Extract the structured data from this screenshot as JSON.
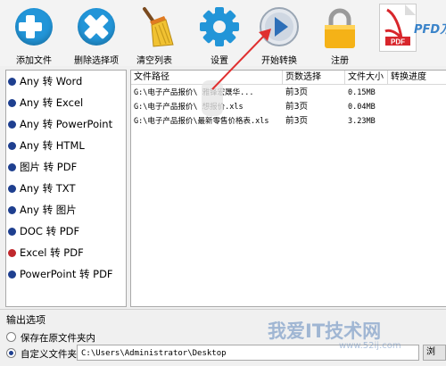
{
  "toolbar": {
    "add_file": "添加文件",
    "delete_selected": "删除选择项",
    "clear_list": "清空列表",
    "settings": "设置",
    "start_convert": "开始转换",
    "register": "注册",
    "brand_partial": "PFD万"
  },
  "converters": [
    {
      "label": "Any 转 Word",
      "color": "#1e3f8f"
    },
    {
      "label": "Any 转 Excel",
      "color": "#1e3f8f"
    },
    {
      "label": "Any 转 PowerPoint",
      "color": "#1e3f8f"
    },
    {
      "label": "Any 转 HTML",
      "color": "#1e3f8f"
    },
    {
      "label": "图片 转 PDF",
      "color": "#1e3f8f"
    },
    {
      "label": "Any 转 TXT",
      "color": "#1e3f8f"
    },
    {
      "label": "Any 转 图片",
      "color": "#1e3f8f"
    },
    {
      "label": "DOC 转 PDF",
      "color": "#1e3f8f"
    },
    {
      "label": "Excel 转 PDF",
      "color": "#c0282d"
    },
    {
      "label": "PowerPoint 转 PDF",
      "color": "#1e3f8f"
    }
  ],
  "table": {
    "headers": [
      "文件路径",
      "页数选择",
      "文件大小",
      "转换进度"
    ],
    "rows": [
      {
        "path": "G:\\电子产品报价\\      雅锋宏晟华...",
        "pages": "前3页",
        "size": "0.15MB",
        "progress": ""
      },
      {
        "path": "G:\\电子产品报价\\   想报价.xls",
        "pages": "前3页",
        "size": "0.04MB",
        "progress": ""
      },
      {
        "path": "G:\\电子产品报价\\最新零售价格表.xls",
        "pages": "前3页",
        "size": "3.23MB",
        "progress": ""
      }
    ]
  },
  "output": {
    "title": "输出选项",
    "option_same_folder": "保存在原文件夹内",
    "option_custom_folder": "自定义文件夹",
    "path": "C:\\Users\\Administrator\\Desktop",
    "browse": "浏"
  },
  "watermark": {
    "text": "我爱IT技术网",
    "url": "www.52ij.com"
  },
  "colors": {
    "accent_blue": "#2295d8",
    "dot_blue": "#1e3f8f",
    "dot_red": "#c0282d",
    "arrow_red": "#e03030"
  }
}
